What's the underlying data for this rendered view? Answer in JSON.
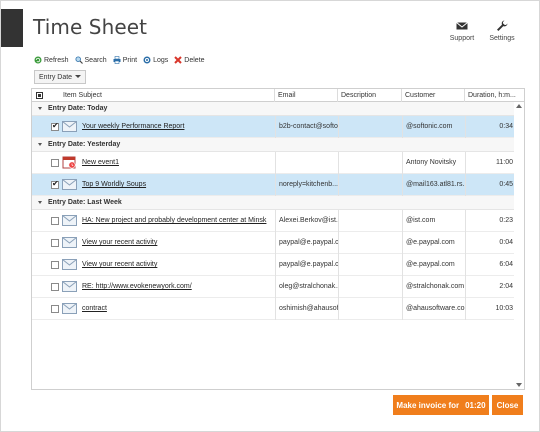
{
  "app": {
    "title": "Time Sheet"
  },
  "top_actions": [
    {
      "label": "Support",
      "icon": "envelope-icon"
    },
    {
      "label": "Settings",
      "icon": "wrench-icon"
    }
  ],
  "toolbar": {
    "refresh": "Refresh",
    "search": "Search",
    "print": "Print",
    "logs": "Logs",
    "delete": "Delete"
  },
  "groupby": {
    "value": "Entry Date"
  },
  "columns": {
    "subject": "Item Subject",
    "email": "Email",
    "description": "Description",
    "customer": "Customer",
    "duration": "Duration, h:m..."
  },
  "groups": [
    {
      "label": "Entry Date: Today",
      "rows": [
        {
          "checked": true,
          "selected": true,
          "icon": "envelope-icon",
          "subject": "Your weekly Performance Report",
          "email": "b2b-contact@softo...",
          "description": "",
          "customer": "@softonic.com",
          "duration": "0:34"
        }
      ]
    },
    {
      "label": "Entry Date: Yesterday",
      "rows": [
        {
          "checked": false,
          "selected": false,
          "icon": "calendar-icon",
          "subject": "New event1",
          "email": "",
          "description": "",
          "customer": "Antony Novitsky",
          "duration": "11:00"
        },
        {
          "checked": true,
          "selected": true,
          "icon": "envelope-icon",
          "subject": "Top 9 Worldly Soups",
          "email": "noreply=kitchenb...",
          "description": "",
          "customer": "@mail163.atl81.rs...",
          "duration": "0:45"
        }
      ]
    },
    {
      "label": "Entry Date: Last Week",
      "rows": [
        {
          "checked": false,
          "selected": false,
          "icon": "envelope-icon",
          "subject": "HA: New project and probably development center at Minsk",
          "email": "Alexei.Berkov@ist...",
          "description": "",
          "customer": "@ist.com",
          "duration": "0:23"
        },
        {
          "checked": false,
          "selected": false,
          "icon": "envelope-icon",
          "subject": "View your recent activity",
          "email": "paypal@e.paypal.c...",
          "description": "",
          "customer": "@e.paypal.com",
          "duration": "0:04"
        },
        {
          "checked": false,
          "selected": false,
          "icon": "envelope-icon",
          "subject": "View your recent activity",
          "email": "paypal@e.paypal.c...",
          "description": "",
          "customer": "@e.paypal.com",
          "duration": "6:04"
        },
        {
          "checked": false,
          "selected": false,
          "icon": "envelope-icon",
          "subject": "RE: http://www.evokenewyork.com/",
          "email": "oleg@stralchonak....",
          "description": "",
          "customer": "@stralchonak.com",
          "duration": "2:04"
        },
        {
          "checked": false,
          "selected": false,
          "icon": "envelope-icon",
          "subject": "contract",
          "email": "oshimish@ahausof...",
          "description": "",
          "customer": "@ahausoftware.com",
          "duration": "10:03"
        }
      ]
    }
  ],
  "footer": {
    "invoice_label": "Make invoice for",
    "invoice_total": "01:20",
    "close_label": "Close"
  },
  "colors": {
    "accent": "#f07e1c",
    "selected_row": "#cde6f7",
    "badge": "#333333"
  }
}
